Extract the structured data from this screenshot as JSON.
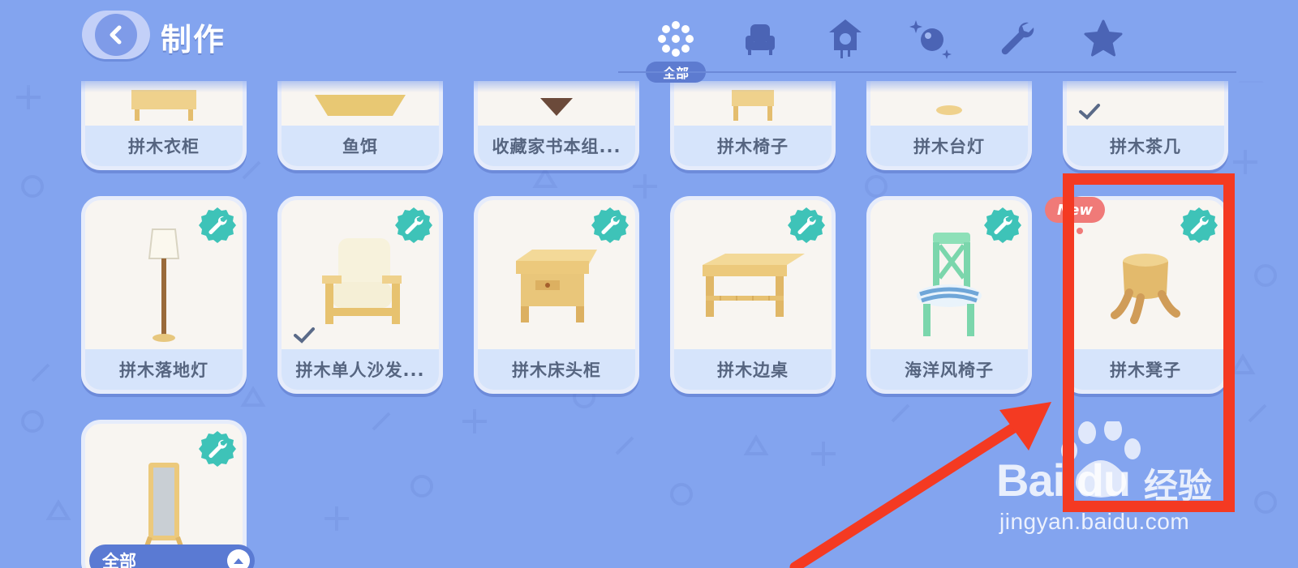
{
  "header": {
    "title": "制作",
    "tabs": [
      {
        "icon": "all-flower-icon",
        "active": true,
        "label": "全部"
      },
      {
        "icon": "armchair-icon",
        "active": false
      },
      {
        "icon": "cuckoo-clock-icon",
        "active": false
      },
      {
        "icon": "sparkle-ball-icon",
        "active": false
      },
      {
        "icon": "wrench-icon",
        "active": false
      },
      {
        "icon": "star-icon",
        "active": false
      }
    ]
  },
  "items_row1": [
    {
      "label": "拼木衣柜"
    },
    {
      "label": "鱼饵"
    },
    {
      "label": "收藏家书本组..."
    },
    {
      "label": "拼木椅子"
    },
    {
      "label": "拼木台灯"
    },
    {
      "label": "拼木茶几",
      "owned": true
    }
  ],
  "items_row2": [
    {
      "label": "拼木落地灯",
      "craftable": true
    },
    {
      "label": "拼木单人沙发...",
      "craftable": true,
      "owned": true
    },
    {
      "label": "拼木床头柜",
      "craftable": true
    },
    {
      "label": "拼木边桌",
      "craftable": true
    },
    {
      "label": "海洋风椅子",
      "craftable": true
    },
    {
      "label": "拼木凳子",
      "craftable": true,
      "new_badge": "New"
    }
  ],
  "items_row3": [
    {
      "label": "",
      "craftable": true
    }
  ],
  "filter": {
    "label": "全部"
  },
  "watermark": {
    "brand": "Bai du",
    "cn": "经验",
    "url": "jingyan.baidu.com"
  },
  "colors": {
    "background": "#83a4ef",
    "highlight": "#f43a22",
    "accent": "#5a7ad3",
    "badge": "#3ec3b8"
  }
}
